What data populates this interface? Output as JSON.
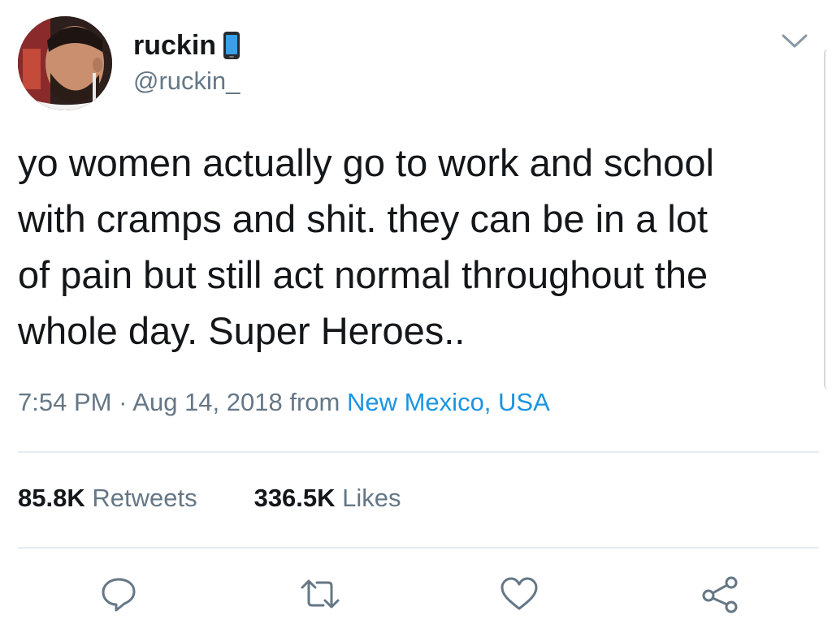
{
  "tweet": {
    "display_name": "ruckin",
    "handle": "@ruckin_",
    "text": "yo women actually go to work and school\nwith cramps and shit. they can be in a lot\nof pain but still act normal throughout the\nwhole day. Super Heroes..",
    "time": "7:54 PM",
    "separator": " · ",
    "date": "Aug 14, 2018",
    "from_label": " from ",
    "location": "New Mexico, USA"
  },
  "stats": {
    "retweets_count": "85.8K",
    "retweets_label": " Retweets",
    "likes_count": "336.5K",
    "likes_label": " Likes"
  },
  "icons": {
    "name_emoji": "mobile-phone-icon",
    "menu": "chevron-down-icon",
    "reply": "reply-icon",
    "retweet": "retweet-icon",
    "like": "heart-icon",
    "share": "share-icon"
  },
  "colors": {
    "text": "#14171a",
    "secondary": "#657786",
    "link": "#1b95e0",
    "divider": "#e6ecf0"
  }
}
